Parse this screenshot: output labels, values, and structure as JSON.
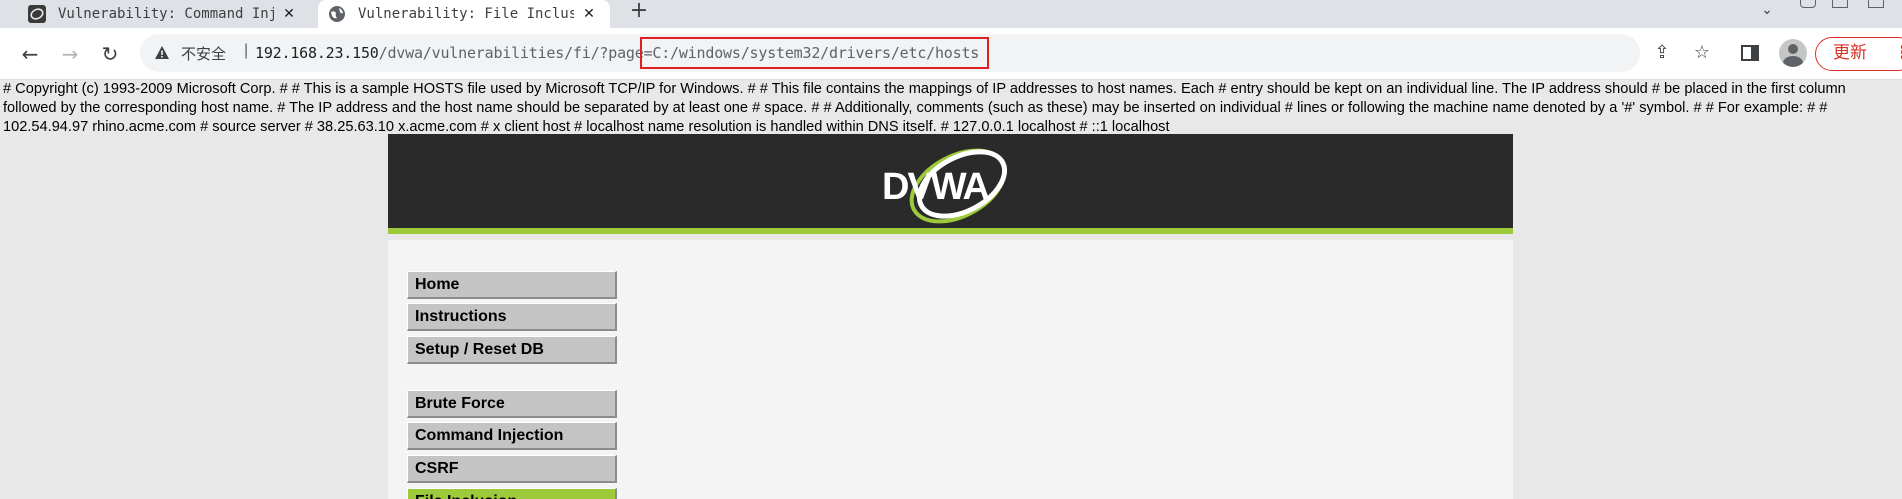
{
  "browser": {
    "tabs": [
      {
        "title": "Vulnerability: Command Injection",
        "favicon": "dvwa-icon",
        "active": false
      },
      {
        "title": "Vulnerability: File Inclusion",
        "favicon": "globe-icon",
        "active": true
      }
    ],
    "new_tab_icon": "plus-icon",
    "security_label": "不安全",
    "url_host": "192.168.23.150",
    "url_path": "/dvwa/vulnerabilities/fi/?page=C:/windows/system32/drivers/etc/hosts",
    "update_label": "更新",
    "update_menu_label": "⋮",
    "accent_color": "#d93025"
  },
  "page": {
    "hosts_text": "# Copyright (c) 1993-2009 Microsoft Corp. # # This is a sample HOSTS file used by Microsoft TCP/IP for Windows. # # This file contains the mappings of IP addresses to host names. Each # entry should be kept on an individual line. The IP address should # be placed in the first column followed by the corresponding host name. # The IP address and the host name should be separated by at least one # space. # # Additionally, comments (such as these) may be inserted on individual # lines or following the machine name denoted by a '#' symbol. # # For example: # # 102.54.94.97 rhino.acme.com # source server # 38.25.63.10 x.acme.com # x client host # localhost name resolution is handled within DNS itself. # 127.0.0.1 localhost # ::1 localhost",
    "logo_text": "DVWA",
    "header_color": "#2a2a2a",
    "accent_green": "#9dca3a",
    "menu": {
      "home": "Home",
      "instructions": "Instructions",
      "setup": "Setup / Reset DB",
      "brute_force": "Brute Force",
      "command_injection": "Command Injection",
      "csrf": "CSRF",
      "file_inclusion": "File Inclusion"
    }
  }
}
